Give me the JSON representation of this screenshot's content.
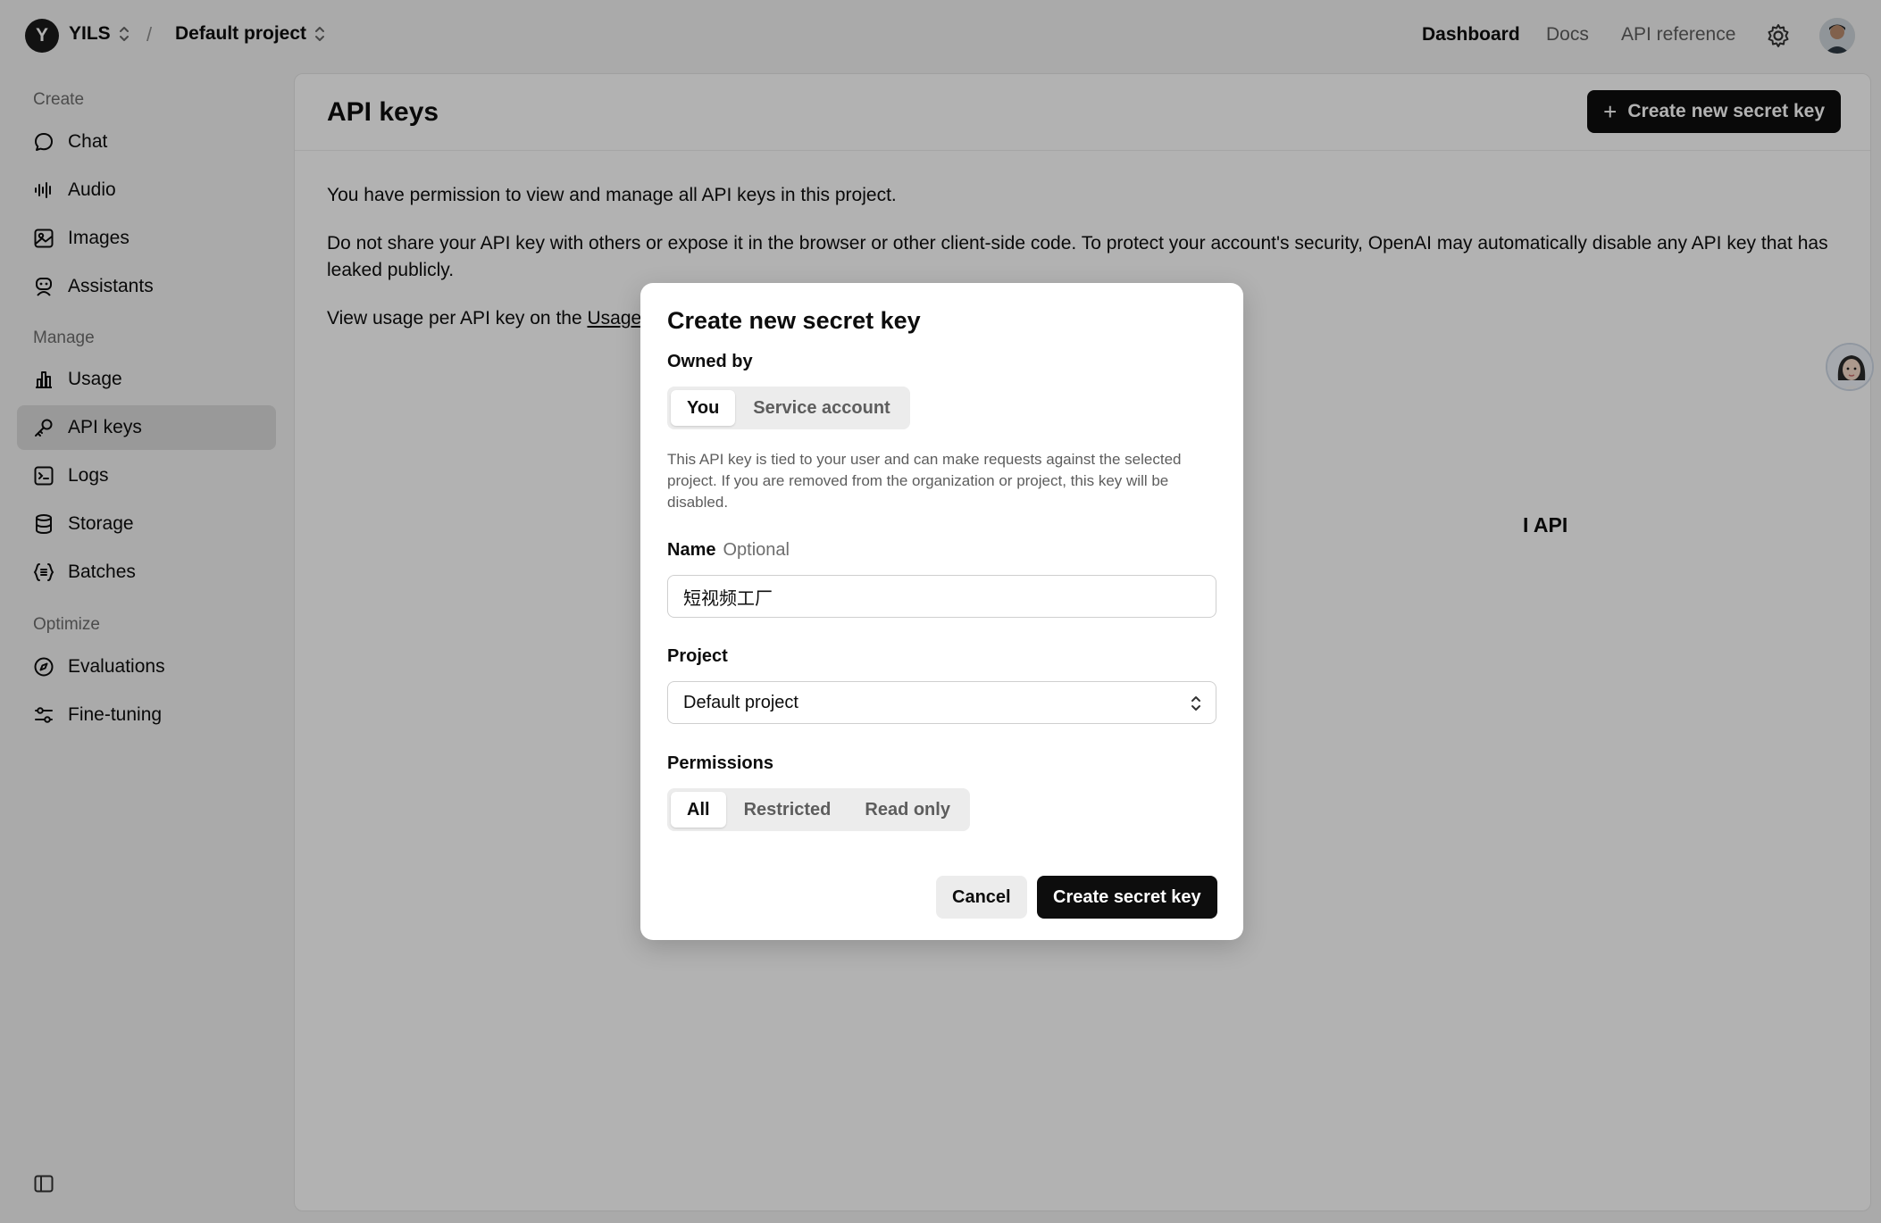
{
  "topbar": {
    "org_initial": "Y",
    "org_name": "YILS",
    "separator": "/",
    "project_name": "Default project",
    "nav": {
      "dashboard": "Dashboard",
      "docs": "Docs",
      "api_reference": "API reference"
    }
  },
  "sidebar": {
    "sections": {
      "create": "Create",
      "manage": "Manage",
      "optimize": "Optimize"
    },
    "items": [
      {
        "label": "Chat",
        "icon": "chat-bubble-icon"
      },
      {
        "label": "Audio",
        "icon": "audio-wave-icon"
      },
      {
        "label": "Images",
        "icon": "image-icon"
      },
      {
        "label": "Assistants",
        "icon": "assistant-icon"
      },
      {
        "label": "Usage",
        "icon": "bar-chart-icon"
      },
      {
        "label": "API keys",
        "icon": "key-icon",
        "active": true
      },
      {
        "label": "Logs",
        "icon": "terminal-icon"
      },
      {
        "label": "Storage",
        "icon": "database-icon"
      },
      {
        "label": "Batches",
        "icon": "braces-icon"
      },
      {
        "label": "Evaluations",
        "icon": "compass-icon"
      },
      {
        "label": "Fine-tuning",
        "icon": "sliders-icon"
      }
    ]
  },
  "main": {
    "title": "API keys",
    "create_button": "Create new secret key",
    "para1": "You have permission to view and manage all API keys in this project.",
    "para2_line1": "Do not share your API key with others or expose it in the browser or other client-side code. To protect your account's security, OpenAI may automatically disable any API key that has",
    "para2_line2": "leaked publicly.",
    "para3_prefix": "View usage per API key on the ",
    "para3_link": "Usage p",
    "behind_heading": "I API"
  },
  "modal": {
    "title": "Create new secret key",
    "owned_by_label": "Owned by",
    "owned_by_options": [
      "You",
      "Service account"
    ],
    "owned_by_selected": "You",
    "helper": "This API key is tied to your user and can make requests against the selected project. If you are removed from the organization or project, this key will be disabled.",
    "name_label": "Name",
    "name_optional": "Optional",
    "name_value": "短视频工厂",
    "project_label": "Project",
    "project_value": "Default project",
    "permissions_label": "Permissions",
    "permissions_options": [
      "All",
      "Restricted",
      "Read only"
    ],
    "permissions_selected": "All",
    "cancel": "Cancel",
    "create": "Create secret key"
  },
  "colors": {
    "accent": "#0d0d0d",
    "sidebar_active": "#dcdcdc",
    "overlay": "rgba(0,0,0,0.30)"
  }
}
